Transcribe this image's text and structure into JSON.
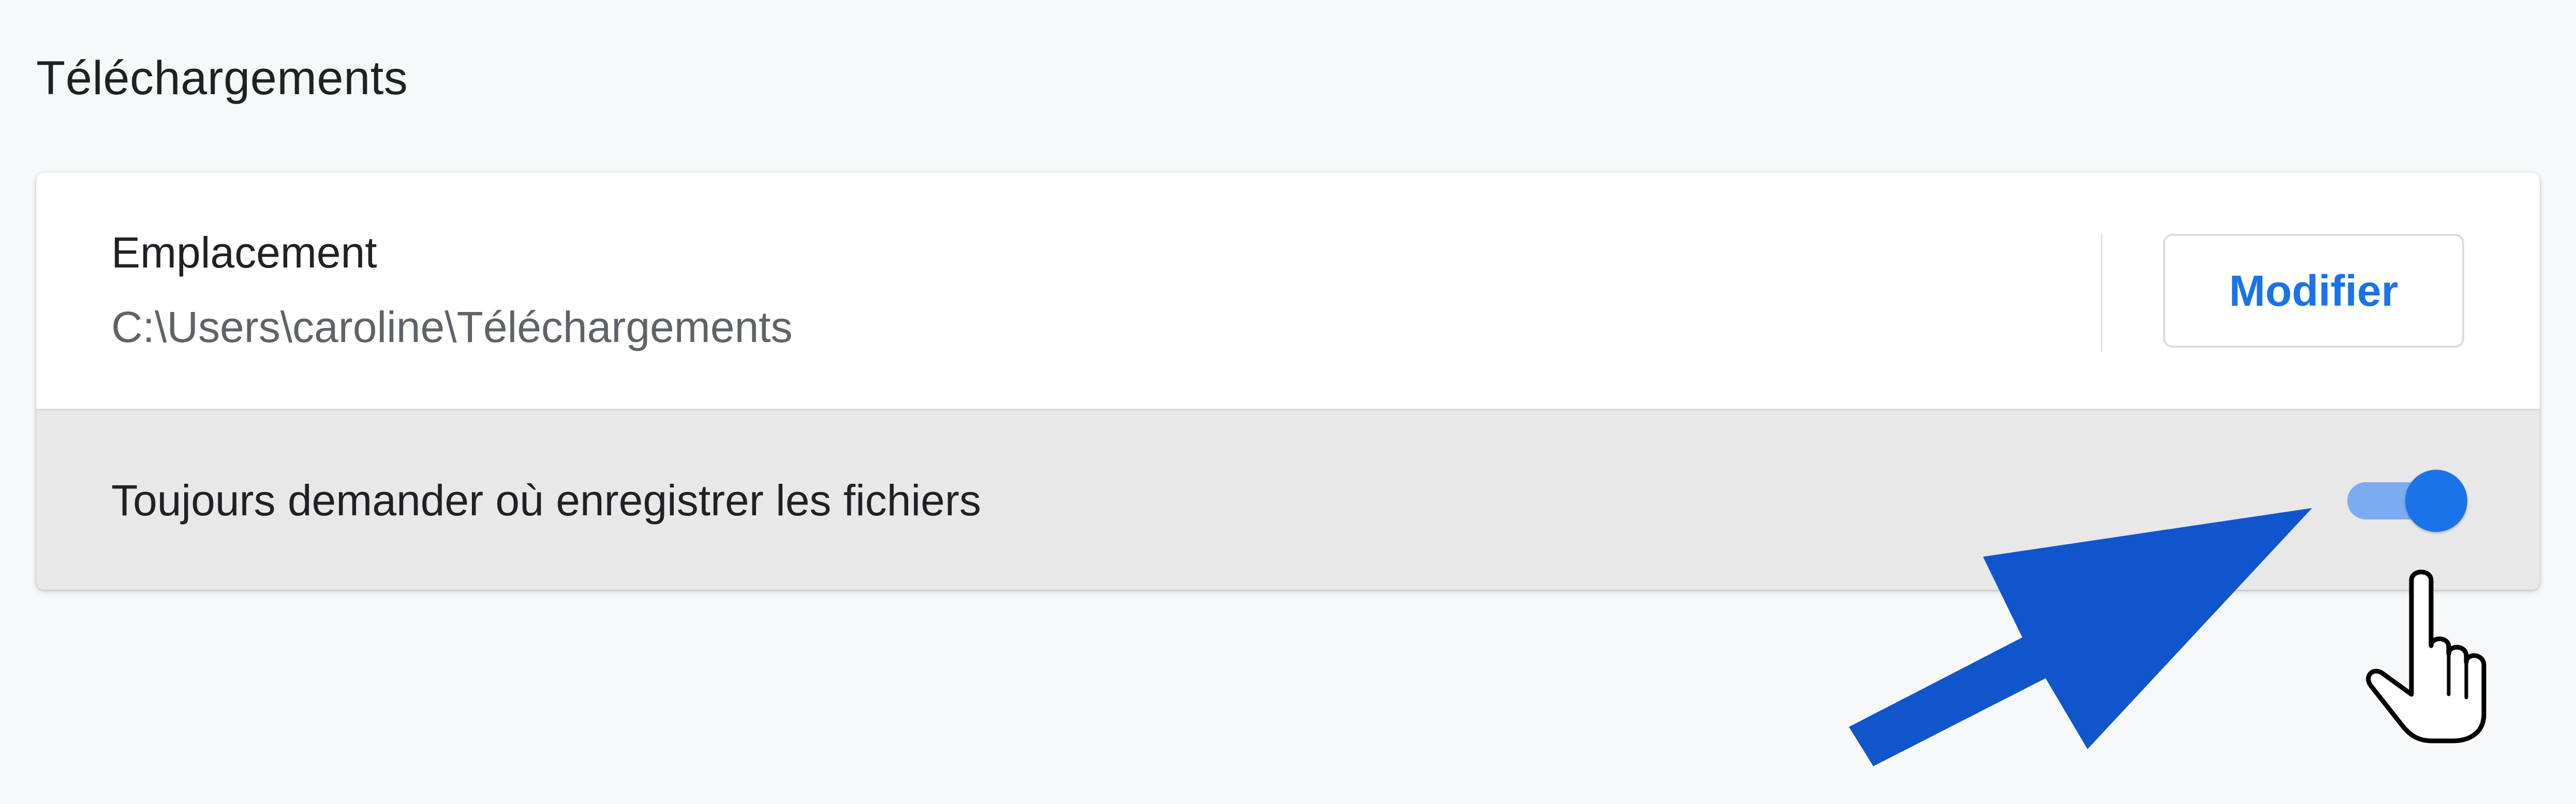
{
  "section": {
    "title": "Téléchargements"
  },
  "location": {
    "label": "Emplacement",
    "path": "C:\\Users\\caroline\\Téléchargements",
    "modify_label": "Modifier"
  },
  "ask_row": {
    "label": "Toujours demander où enregistrer les fichiers",
    "toggle_on": true
  },
  "icons": {
    "cursor": "hand-pointer-icon",
    "annotation": "blue-arrow-icon"
  },
  "colors": {
    "accent": "#1a73e8",
    "toggle_track": "#7cacf0",
    "annotation_arrow": "#1155cc",
    "page_background": "#f7f8fa",
    "highlight_row": "#e8e8e8"
  }
}
